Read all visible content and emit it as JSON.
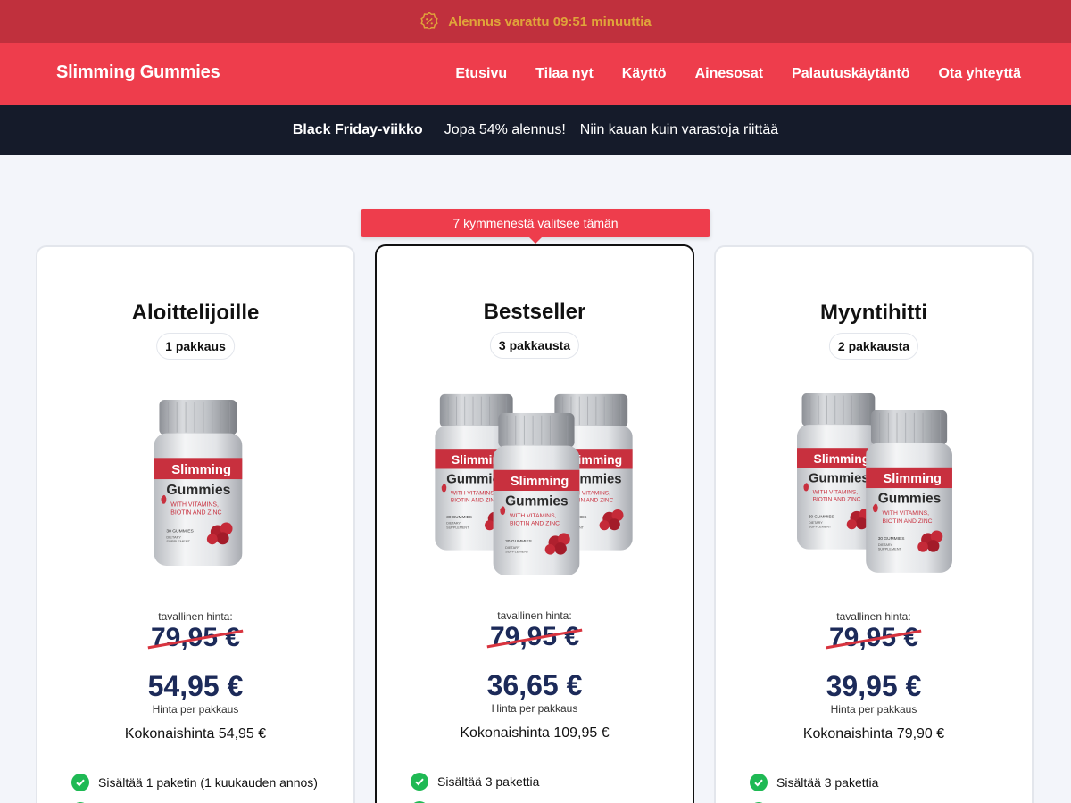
{
  "timer": {
    "text": "Alennus varattu 09:51 minuuttia",
    "icon": "discount-badge-icon"
  },
  "nav": {
    "logo": "Slimming Gummies",
    "links": [
      "Etusivu",
      "Tilaa nyt",
      "Käyttö",
      "Ainesosat",
      "Palautuskäytäntö",
      "Ota yhteyttä"
    ]
  },
  "promo": {
    "event": "Black Friday-viikko",
    "discount": "Jopa 54% alennus!",
    "stock": "Niin kauan kuin varastoja riittää"
  },
  "ribbon": "7 kymmenestä valitsee tämän",
  "cards": [
    {
      "title": "Aloittelijoille",
      "pack": "1 pakkaus",
      "regular_label": "tavallinen hinta:",
      "old_price": "79,95 €",
      "price": "54,95 €",
      "per_label": "Hinta per pakkaus",
      "total": "Kokonaishinta 54,95 €",
      "feature": "Sisältää 1 paketin (1 kuukauden annos)"
    },
    {
      "title": "Bestseller",
      "pack": "3 pakkausta",
      "regular_label": "tavallinen hinta:",
      "old_price": "79,95 €",
      "price": "36,65 €",
      "per_label": "Hinta per pakkaus",
      "total": "Kokonaishinta 109,95 €",
      "feature": "Sisältää 3 pakettia"
    },
    {
      "title": "Myyntihitti",
      "pack": "2 pakkausta",
      "regular_label": "tavallinen hinta:",
      "old_price": "79,95 €",
      "price": "39,95 €",
      "per_label": "Hinta per pakkaus",
      "total": "Kokonaishinta 79,90 €",
      "feature": "Sisältää 3 pakettia"
    }
  ],
  "product_label": {
    "line1": "Slimming",
    "line2": "Gummies",
    "line3": "WITH VITAMINS,",
    "line4": "BIOTIN AND ZINC",
    "line5": "30 GUMMIES",
    "line6": "DIETARY",
    "line7": "SUPPLEMENT"
  },
  "colors": {
    "header_red": "#ee3d4c",
    "timer_bg": "#c0303d",
    "timer_text": "#e0a43a",
    "promo_bg": "#151b2a",
    "price_navy": "#1c2a59",
    "check_green": "#1fb954"
  }
}
